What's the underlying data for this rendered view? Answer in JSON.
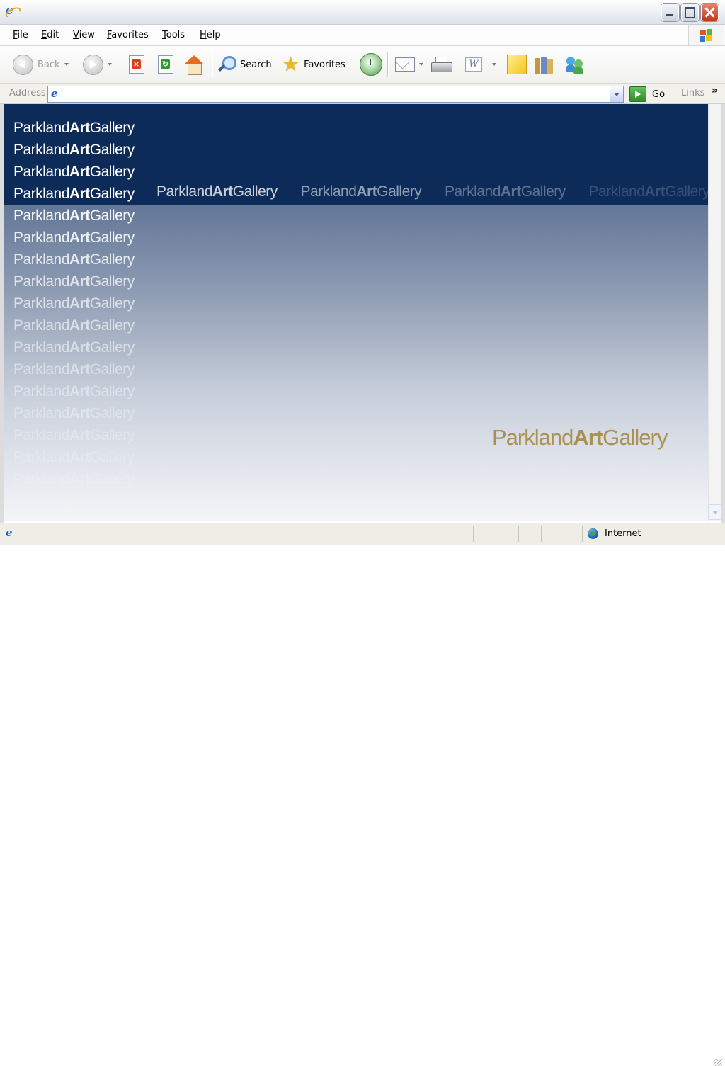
{
  "window": {
    "title": "",
    "controls": [
      "minimize",
      "maximize",
      "close"
    ]
  },
  "menu": {
    "items": [
      {
        "label": "File"
      },
      {
        "label": "Edit"
      },
      {
        "label": "View"
      },
      {
        "label": "Favorites"
      },
      {
        "label": "Tools"
      },
      {
        "label": "Help"
      }
    ]
  },
  "toolbar": {
    "back_label": "Back",
    "search_label": "Search",
    "favorites_label": "Favorites"
  },
  "address": {
    "label": "Address",
    "value": "",
    "go_label": "Go",
    "links_label": "Links",
    "links_chevron": "»"
  },
  "page": {
    "logo": {
      "part1": "Parkland",
      "part2": "Art",
      "part3": "Gallery"
    },
    "colors": {
      "band": "#0d2b58",
      "gold": "#ab914f"
    }
  },
  "status": {
    "zone": "Internet"
  }
}
